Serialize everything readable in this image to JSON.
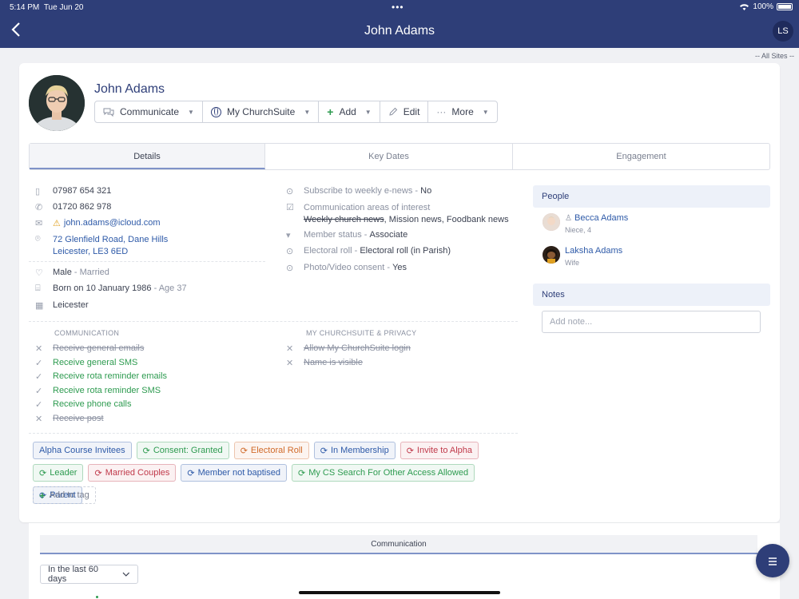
{
  "status_bar": {
    "time": "5:14 PM",
    "date": "Tue Jun 20",
    "battery": "100%"
  },
  "header": {
    "title": "John Adams",
    "user_initials": "LS"
  },
  "site_selector": "-- All Sites --",
  "profile": {
    "name": "John Adams",
    "actions": [
      {
        "label": "Communicate",
        "icon": "chat-icon"
      },
      {
        "label": "My ChurchSuite",
        "icon": "globe-icon"
      },
      {
        "label": "Add",
        "icon": "plus-icon"
      },
      {
        "label": "Edit",
        "icon": "pencil-icon"
      },
      {
        "label": "More",
        "icon": "ellipsis-icon"
      }
    ]
  },
  "tabs": [
    "Details",
    "Key Dates",
    "Engagement"
  ],
  "contact": {
    "mobile": "07987 654 321",
    "phone": "01720 862 978",
    "email": "john.adams@icloud.com",
    "address_line1": "72 Glenfield Road, Dane Hills",
    "address_line2": "Leicester, LE3 6ED"
  },
  "personal": {
    "sex": "Male",
    "marital": "- Married",
    "born": "Born on 10 January 1986",
    "age": "- Age 37",
    "site": "Leicester"
  },
  "custom_fields": {
    "subscribe_label": "Subscribe to weekly e-news - ",
    "subscribe_value": "No",
    "comm_areas_label": "Communication areas of interest",
    "comm_areas_struck": "Weekly church news",
    "comm_areas_rest": ", Mission news, Foodbank news",
    "member_status_label": "Member status - ",
    "member_status_value": "Associate",
    "electoral_label": "Electoral roll - ",
    "electoral_value": "Electoral roll (in Parish)",
    "photo_label": "Photo/Video consent - ",
    "photo_value": "Yes"
  },
  "communication": {
    "heading": "COMMUNICATION",
    "items": [
      {
        "label": "Receive general emails",
        "enabled": false
      },
      {
        "label": "Receive general SMS",
        "enabled": true
      },
      {
        "label": "Receive rota reminder emails",
        "enabled": true
      },
      {
        "label": "Receive rota reminder SMS",
        "enabled": true
      },
      {
        "label": "Receive phone calls",
        "enabled": true
      },
      {
        "label": "Receive post",
        "enabled": false
      }
    ]
  },
  "privacy": {
    "heading": "MY CHURCHSUITE & PRIVACY",
    "items": [
      {
        "label": "Allow My ChurchSuite login",
        "enabled": false
      },
      {
        "label": "Name is visible",
        "enabled": false
      }
    ]
  },
  "tags": [
    {
      "label": "Alpha Course Invitees",
      "sync": false,
      "color": "#2e5aa8"
    },
    {
      "label": "Consent: Granted",
      "sync": true,
      "color": "#2e9b50"
    },
    {
      "label": "Electoral Roll",
      "sync": true,
      "color": "#d06a2a"
    },
    {
      "label": "In Membership",
      "sync": true,
      "color": "#2e5aa8"
    },
    {
      "label": "Invite to Alpha",
      "sync": true,
      "color": "#c0394a"
    },
    {
      "label": "Leader",
      "sync": true,
      "color": "#2e9b50"
    },
    {
      "label": "Married Couples",
      "sync": true,
      "color": "#c0394a"
    },
    {
      "label": "Member not baptised",
      "sync": true,
      "color": "#2e5aa8"
    },
    {
      "label": "My CS Search For Other Access Allowed",
      "sync": true,
      "color": "#2e9b50"
    },
    {
      "label": "Parent",
      "sync": true,
      "color": "#2e5aa8"
    }
  ],
  "add_tag_label": "Add to tag",
  "people": {
    "heading": "People",
    "items": [
      {
        "name": "Becca Adams",
        "relation": "Niece, 4"
      },
      {
        "name": "Laksha Adams",
        "relation": "Wife"
      }
    ]
  },
  "notes": {
    "heading": "Notes",
    "placeholder": "Add note..."
  },
  "bottom": {
    "section_title": "Communication",
    "period": "In the last 60 days"
  }
}
